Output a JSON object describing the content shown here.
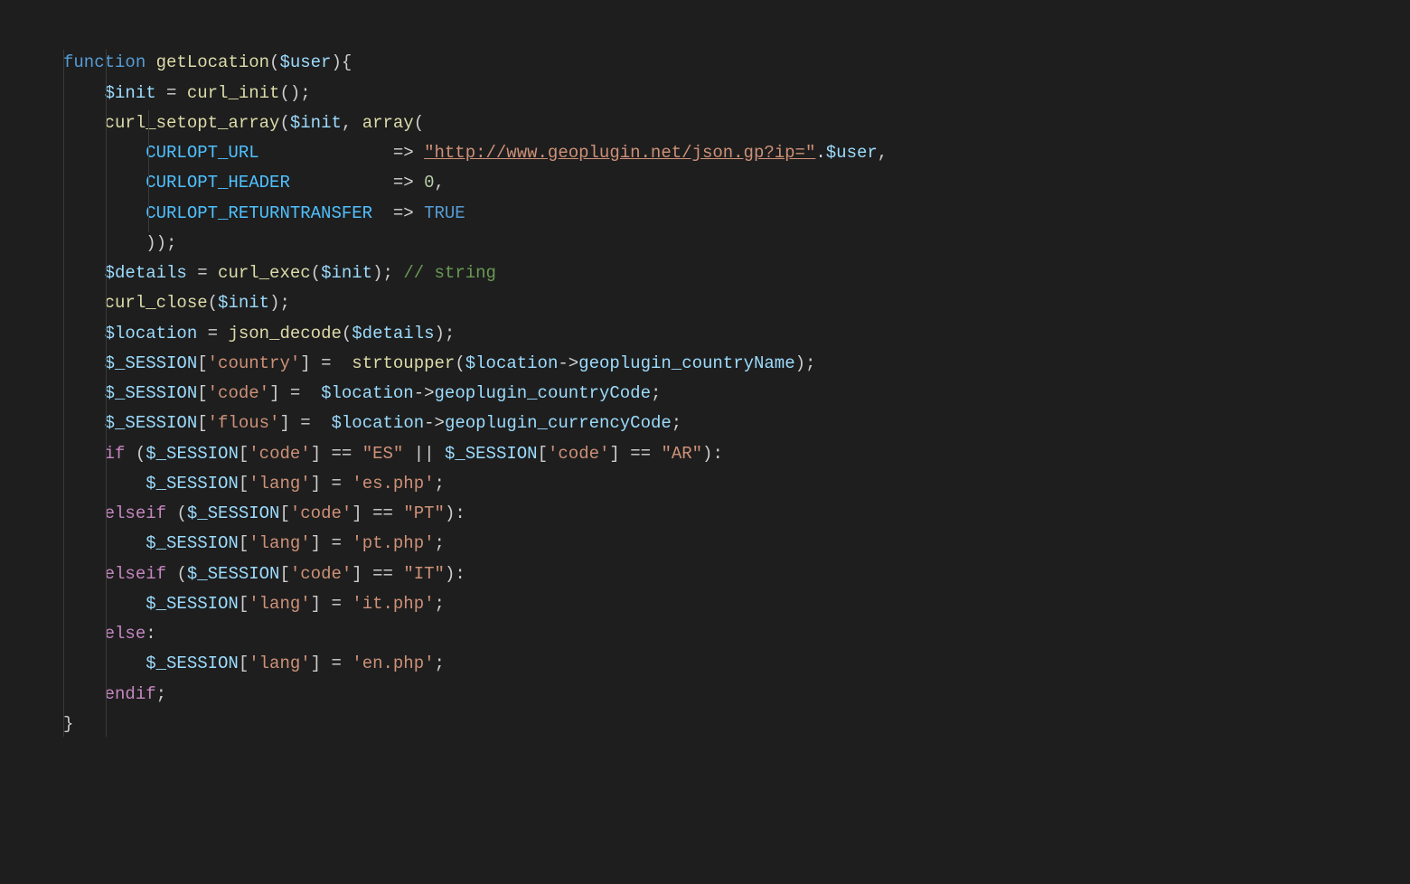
{
  "kw_function": "function",
  "fn_name": "getLocation",
  "var_user": "$user",
  "var_init": "$init",
  "var_details": "$details",
  "var_location": "$location",
  "var_session": "$_SESSION",
  "fn_curl_init": "curl_init",
  "fn_curl_setopt_array": "curl_setopt_array",
  "fn_array": "array",
  "fn_curl_exec": "curl_exec",
  "fn_curl_close": "curl_close",
  "fn_json_decode": "json_decode",
  "fn_strtoupper": "strtoupper",
  "const_url": "CURLOPT_URL",
  "const_header": "CURLOPT_HEADER",
  "const_return": "CURLOPT_RETURNTRANSFER",
  "str_url": "\"http://www.geoplugin.net/json.gp?ip=\"",
  "num_zero": "0",
  "kw_true": "TRUE",
  "cm_string": "// string",
  "str_country": "'country'",
  "str_code": "'code'",
  "str_flous": "'flous'",
  "str_lang": "'lang'",
  "str_ES": "\"ES\"",
  "str_AR": "\"AR\"",
  "str_PT": "\"PT\"",
  "str_IT": "\"IT\"",
  "str_es_php": "'es.php'",
  "str_pt_php": "'pt.php'",
  "str_it_php": "'it.php'",
  "str_en_php": "'en.php'",
  "prop_countryName": "geoplugin_countryName",
  "prop_countryCode": "geoplugin_countryCode",
  "prop_currencyCode": "geoplugin_currencyCode",
  "kw_if": "if",
  "kw_elseif": "elseif",
  "kw_else": "else",
  "kw_endif": "endif"
}
